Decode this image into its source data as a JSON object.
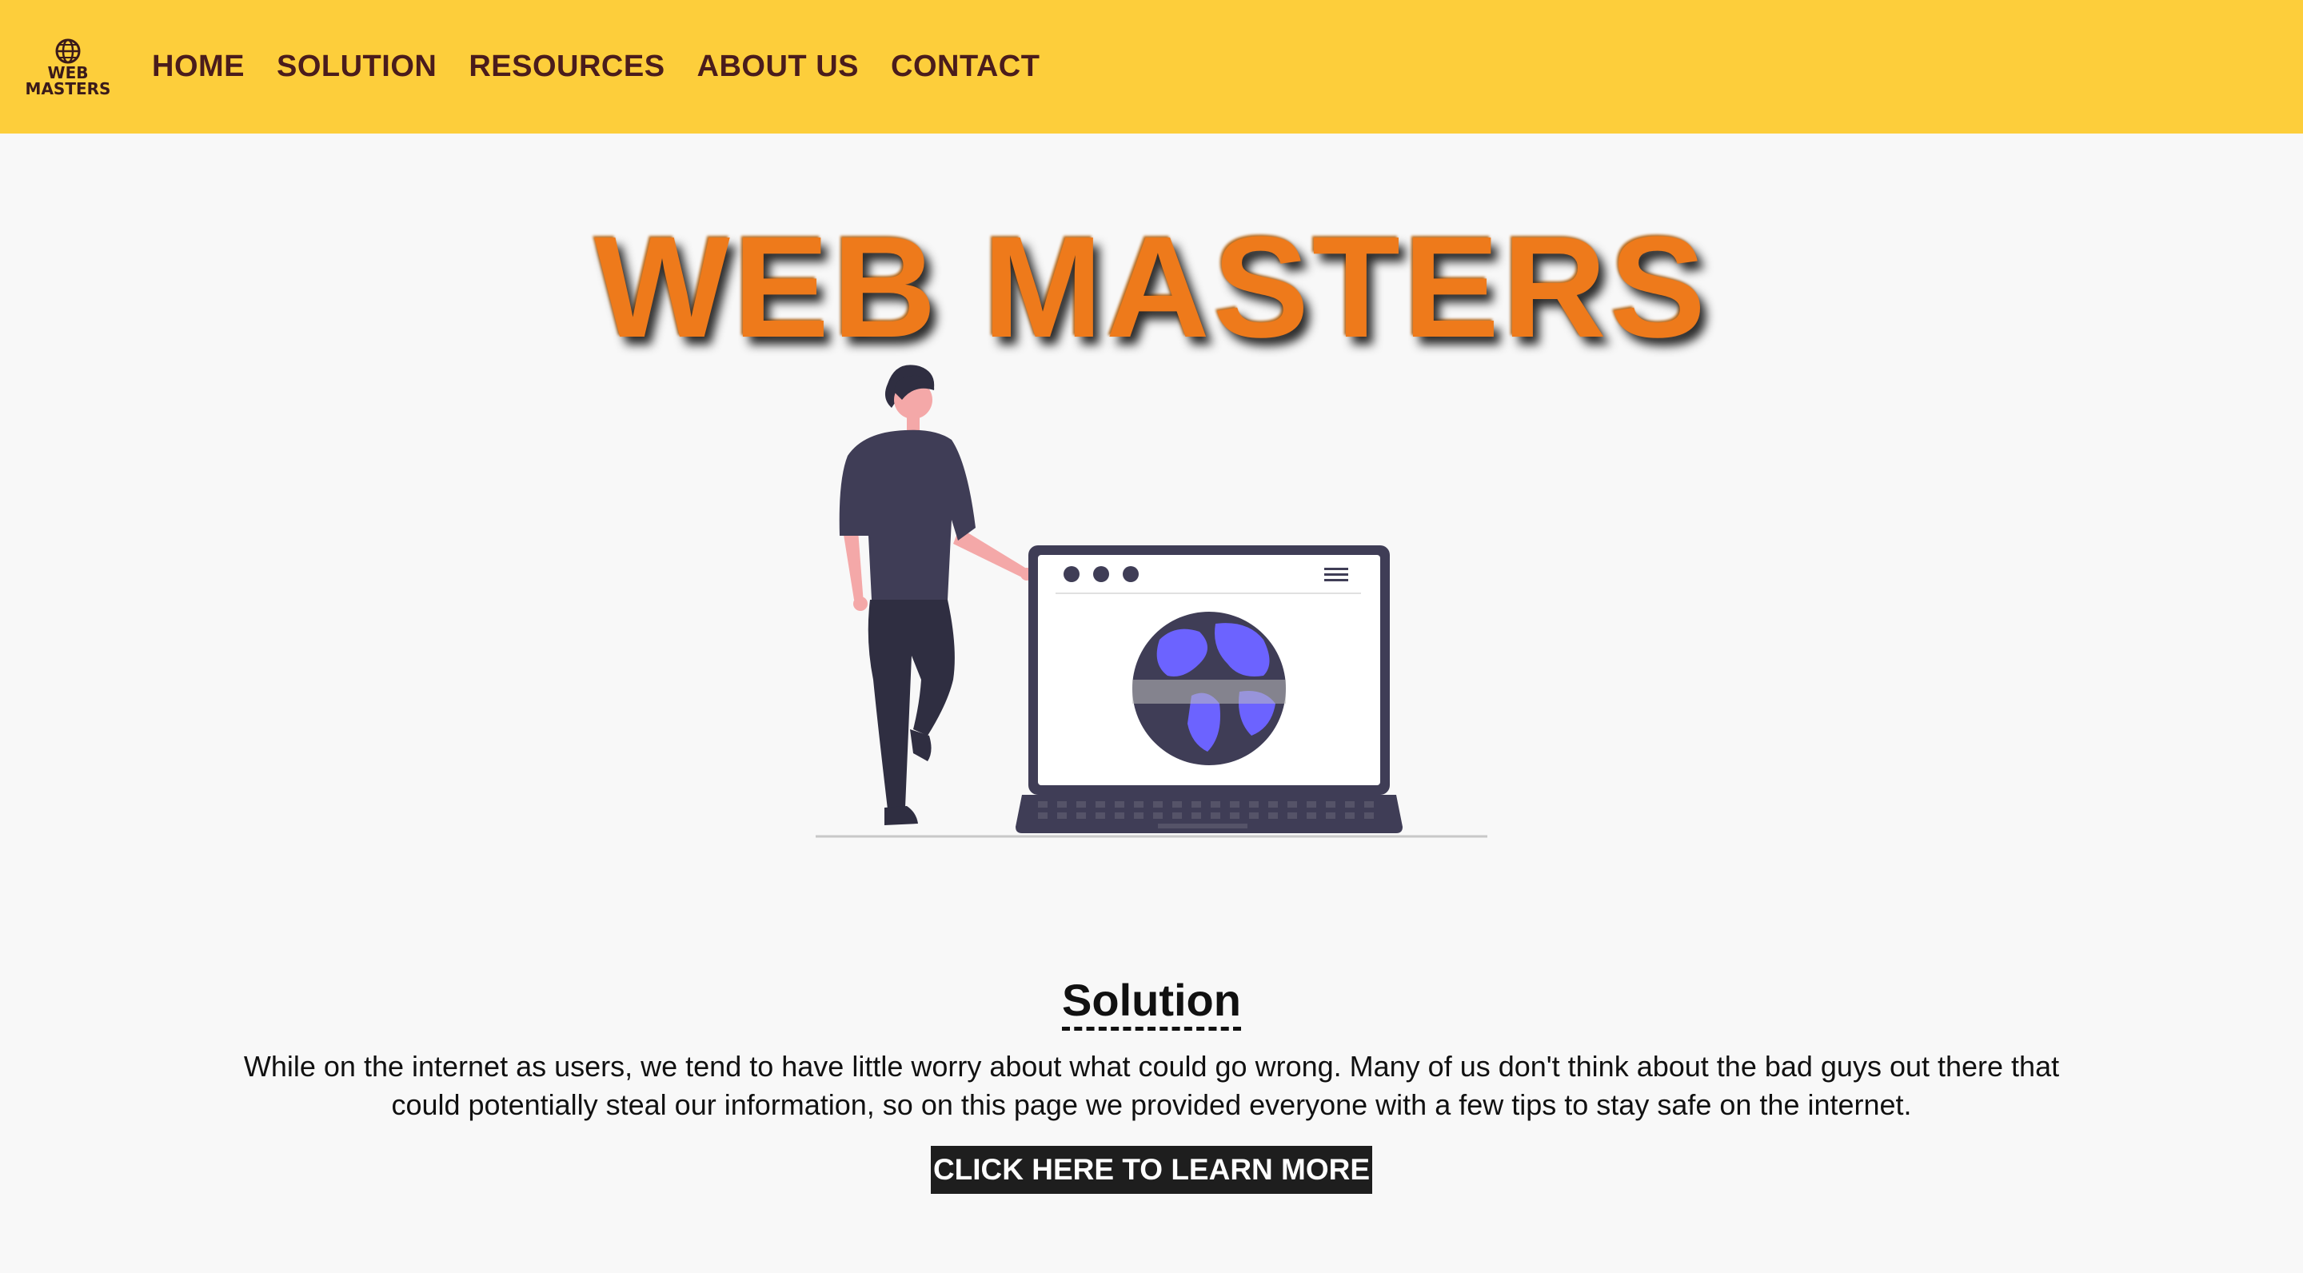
{
  "navbar": {
    "logo": {
      "line1": "WEB",
      "line2": "MASTERS",
      "icon": "globe-icon"
    },
    "links": [
      "HOME",
      "SOLUTION",
      "RESOURCES",
      "ABOUT US",
      "CONTACT"
    ],
    "background": "#fdce3b",
    "link_color": "#4a1c1c"
  },
  "hero": {
    "title": "WEB MASTERS",
    "title_color": "#ee7a1b",
    "illustration": "person-with-website-laptop"
  },
  "solution": {
    "title": "Solution",
    "text": "While on the internet as users, we tend to have little worry about what could go wrong. Many of us don't think about the bad guys out there that could potentially steal our information, so on this page we provided everyone with a few tips to stay safe on the internet.",
    "button_label": "CLICK HERE TO LEARN MORE"
  },
  "colors": {
    "page_background": "#f8f8f8",
    "globe": "#6c63ff",
    "shirt": "#3f3d56",
    "pants": "#2f2e41",
    "skin": "#f4a8a8"
  }
}
